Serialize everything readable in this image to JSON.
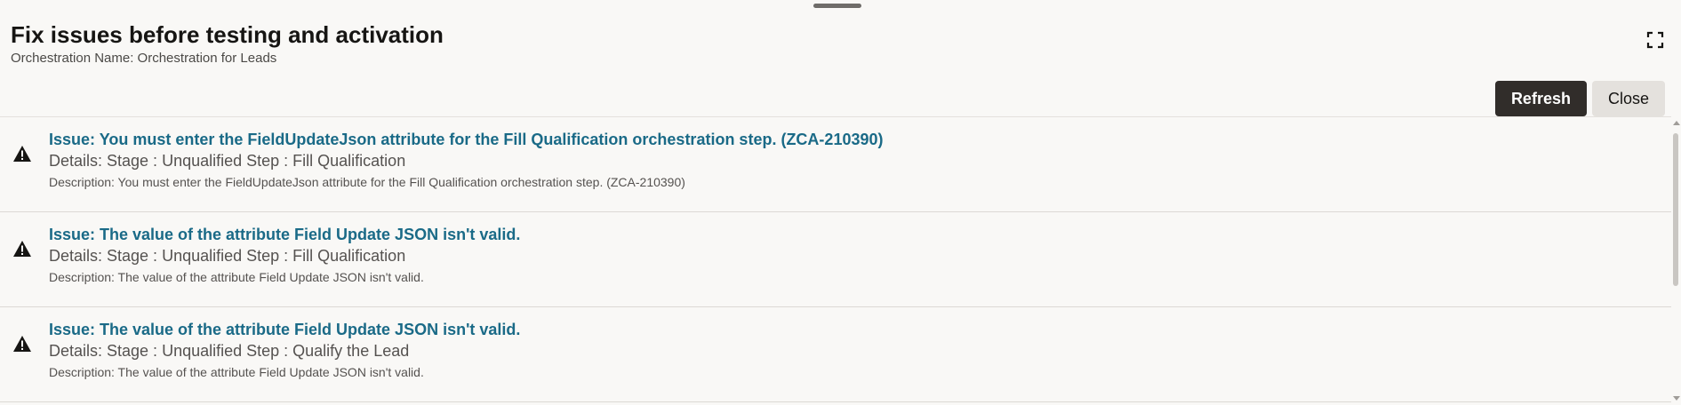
{
  "dialog": {
    "title": "Fix issues before testing and activation",
    "subtitle": "Orchestration Name: Orchestration for Leads",
    "expand_icon": "expand-icon"
  },
  "toolbar": {
    "refresh_label": "Refresh",
    "close_label": "Close"
  },
  "issues": [
    {
      "icon": "warning-icon",
      "title": "Issue: You must enter the FieldUpdateJson attribute for the Fill Qualification orchestration step. (ZCA-210390)",
      "details": "Details: Stage : Unqualified Step : Fill Qualification",
      "description": "Description: You must enter the FieldUpdateJson attribute for the Fill Qualification orchestration step. (ZCA-210390)"
    },
    {
      "icon": "warning-icon",
      "title": "Issue: The value of the attribute Field Update JSON isn't valid.",
      "details": "Details: Stage : Unqualified Step : Fill Qualification",
      "description": "Description: The value of the attribute Field Update JSON isn't valid."
    },
    {
      "icon": "warning-icon",
      "title": "Issue: The value of the attribute Field Update JSON isn't valid.",
      "details": "Details: Stage : Unqualified Step : Qualify the Lead",
      "description": "Description: The value of the attribute Field Update JSON isn't valid."
    }
  ],
  "colors": {
    "background": "#f9f8f6",
    "link": "#1a6a87",
    "primary_button": "#312d2a",
    "secondary_button": "#e4e1dd"
  }
}
